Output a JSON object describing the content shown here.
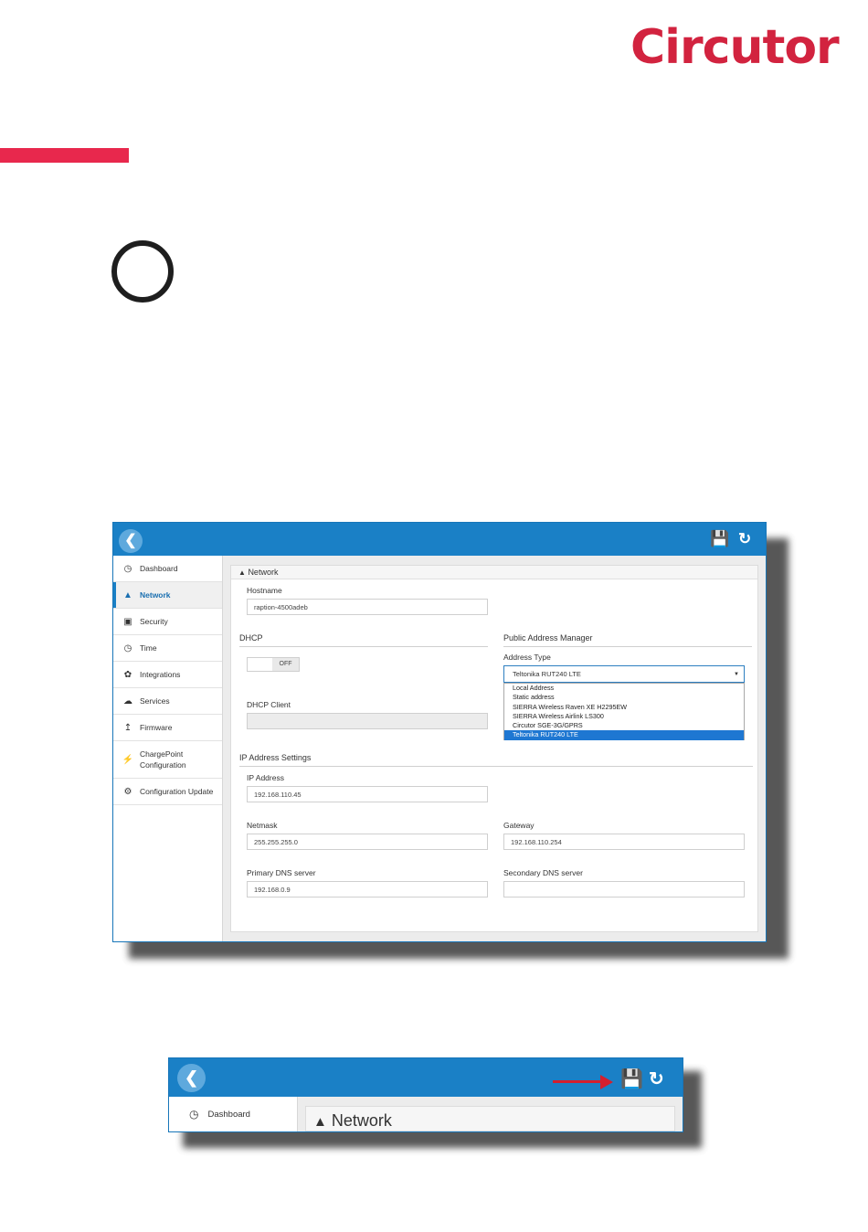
{
  "brand": {
    "logo_text": "Circutor",
    "accent_color": "#e8284d"
  },
  "screenshot1": {
    "topbar": {
      "back_icon": "chevron-left-icon",
      "save_icon": "floppy-save-icon",
      "refresh_icon": "refresh-icon"
    },
    "sidebar": [
      {
        "icon": "dashboard-icon",
        "label": "Dashboard"
      },
      {
        "icon": "road-icon",
        "label": "Network",
        "active": true
      },
      {
        "icon": "lock-icon",
        "label": "Security"
      },
      {
        "icon": "clock-icon",
        "label": "Time"
      },
      {
        "icon": "integrations-icon",
        "label": "Integrations"
      },
      {
        "icon": "cloud-icon",
        "label": "Services"
      },
      {
        "icon": "upload-icon",
        "label": "Firmware"
      },
      {
        "icon": "bolt-icon",
        "label": "ChargePoint Configuration"
      },
      {
        "icon": "gear-icon",
        "label": "Configuration Update"
      }
    ],
    "panel_title": "Network",
    "hostname": {
      "label": "Hostname",
      "value": "raption-4500adeb"
    },
    "dhcp": {
      "section": "DHCP",
      "toggle_off": "OFF",
      "client_label": "DHCP Client",
      "client_value": ""
    },
    "public_address": {
      "section": "Public Address Manager",
      "address_type_label": "Address Type",
      "selected": "Teltonika RUT240 LTE",
      "options": [
        "Local Address",
        "Static address",
        "SIERRA Wireless Raven XE H2295EW",
        "SIERRA Wireless Airlink LS300",
        "Circutor SGE-3G/GPRS",
        "Teltonika RUT240 LTE"
      ]
    },
    "ip_settings": {
      "section": "IP Address Settings",
      "ip_label": "IP Address",
      "ip_value": "192.168.110.45",
      "netmask_label": "Netmask",
      "netmask_value": "255.255.255.0",
      "gateway_label": "Gateway",
      "gateway_value": "192.168.110.254",
      "dns1_label": "Primary DNS server",
      "dns1_value": "192.168.0.9",
      "dns2_label": "Secondary DNS server",
      "dns2_value": ""
    }
  },
  "screenshot2": {
    "sidebar_label": "Dashboard",
    "panel_title": "Network",
    "arrow_color": "#d41f2e"
  }
}
